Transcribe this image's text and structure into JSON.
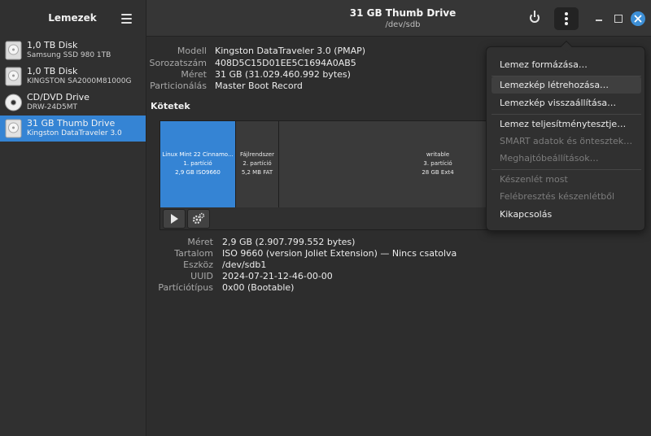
{
  "sidebar": {
    "title": "Lemezek",
    "disks": [
      {
        "name": "1,0 TB Disk",
        "sub": "Samsung SSD 980 1TB",
        "icon": "hard-disk-icon"
      },
      {
        "name": "1,0 TB Disk",
        "sub": "KINGSTON SA2000M81000G",
        "icon": "hard-disk-icon"
      },
      {
        "name": "CD/DVD Drive",
        "sub": "DRW-24D5MT",
        "icon": "optical-disc-icon"
      },
      {
        "name": "31 GB Thumb Drive",
        "sub": "Kingston DataTraveler 3.0",
        "icon": "usb-drive-icon",
        "selected": true
      }
    ]
  },
  "header": {
    "title": "31 GB Thumb Drive",
    "subtitle": "/dev/sdb"
  },
  "drive_info": {
    "model_label": "Modell",
    "model": "Kingston DataTraveler 3.0 (PMAP)",
    "serial_label": "Sorozatszám",
    "serial": "408D5C15D01EE5C1694A0AB5",
    "size_label": "Méret",
    "size": "31 GB (31.029.460.992 bytes)",
    "partitioning_label": "Particionálás",
    "partitioning": "Master Boot Record"
  },
  "volumes": {
    "heading": "Kötetek",
    "partitions": [
      {
        "name": "Linux Mint 22 Cinnamo...",
        "num": "1. partíció",
        "detail": "2,9 GB ISO9660"
      },
      {
        "name": "Fájlrendszer",
        "num": "2. partíció",
        "detail": "5,2 MB FAT"
      },
      {
        "name": "writable",
        "num": "3. partíció",
        "detail": "28 GB Ext4"
      }
    ]
  },
  "volume_info": {
    "size_label": "Méret",
    "size": "2,9 GB (2.907.799.552 bytes)",
    "content_label": "Tartalom",
    "content": "ISO 9660 (version Joliet Extension) — Nincs csatolva",
    "device_label": "Eszköz",
    "device": "/dev/sdb1",
    "uuid_label": "UUID",
    "uuid": "2024-07-21-12-46-00-00",
    "parttype_label": "Partíciótípus",
    "parttype": "0x00 (Bootable)"
  },
  "menu": {
    "items": [
      {
        "label": "Lemez formázása…",
        "enabled": true
      },
      {
        "label": "Lemezkép létrehozása…",
        "enabled": true,
        "hover": true
      },
      {
        "label": "Lemezkép visszaállítása…",
        "enabled": true
      },
      {
        "label": "Lemez teljesítménytesztje…",
        "enabled": true
      },
      {
        "label": "SMART adatok és öntesztek…",
        "enabled": false
      },
      {
        "label": "Meghajtóbeállítások…",
        "enabled": false
      },
      {
        "label": "Készenlét most",
        "enabled": false
      },
      {
        "label": "Felébresztés készenlétből",
        "enabled": false
      },
      {
        "label": "Kikapcsolás",
        "enabled": true
      }
    ]
  },
  "colors": {
    "accent": "#3584d4",
    "background": "#2d2d2d",
    "close_button": "#3d8fd6"
  }
}
